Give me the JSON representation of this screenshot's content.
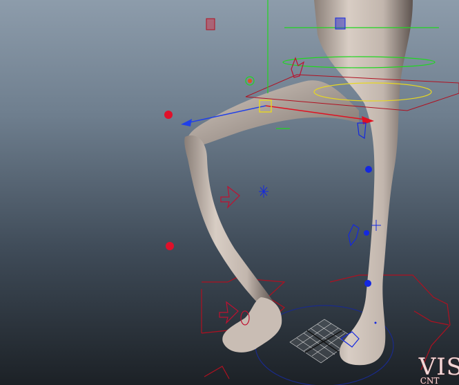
{
  "viewport": {
    "label_line1": "VIS",
    "label_line2": "CNT"
  },
  "colors": {
    "background_top": "#8d9cab",
    "background_bottom": "#1c2126",
    "skin": "#c9bdb4",
    "control_red": "#e0102a",
    "control_blue": "#1428e0",
    "control_green": "#1fd81f",
    "control_yellow": "#f0e020",
    "ground_blue": "#1a2a8a"
  },
  "icons": [
    "pole-vector-marker",
    "ik-handle",
    "foot-control",
    "translate-manipulator",
    "grid-icon"
  ]
}
